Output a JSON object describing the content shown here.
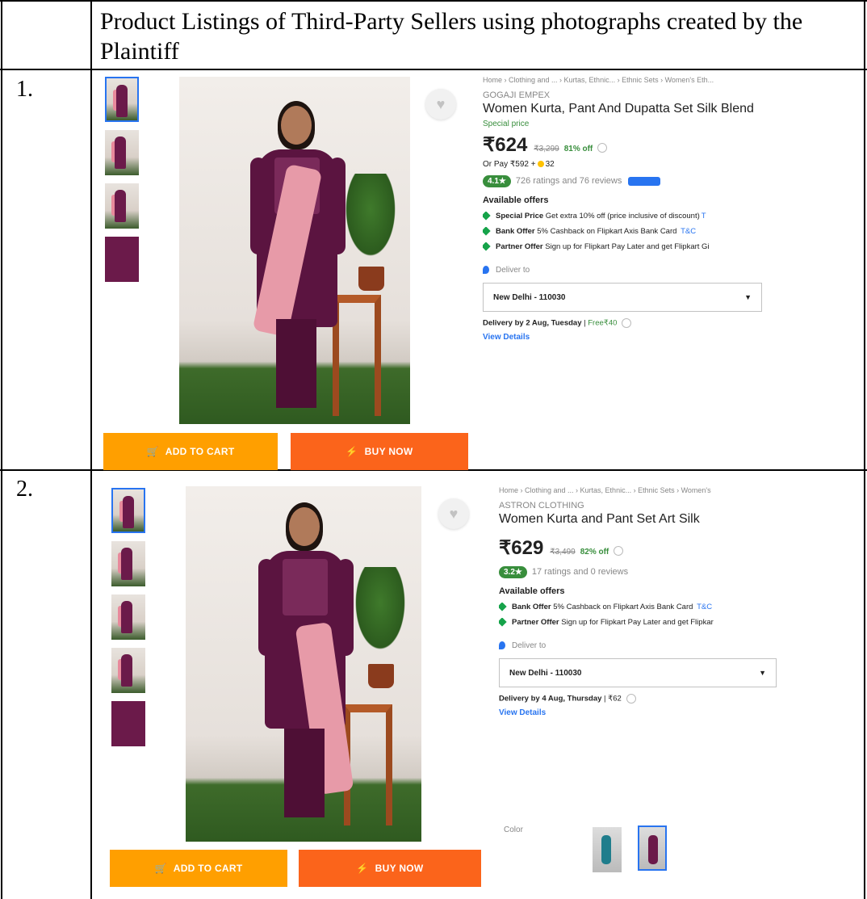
{
  "header": {
    "title": "Product Listings of Third-Party Sellers using photographs created by the Plaintiff"
  },
  "rows": [
    {
      "number": "1.",
      "breadcrumb": "Home › Clothing and ... › Kurtas, Ethnic... › Ethnic Sets › Women's Eth...",
      "brand": "GOGAJI EMPEX",
      "title": "Women Kurta, Pant And Dupatta Set Silk Blend",
      "special": "Special price",
      "price": "₹624",
      "mrp": "₹3,299",
      "off": "81% off",
      "or_pay": "Or Pay ₹592 +",
      "or_pay_coins": "32",
      "rating": "4.1★",
      "rating_text": "726 ratings and 76 reviews",
      "offers_heading": "Available offers",
      "offers": [
        {
          "bold": "Special Price",
          "text": " Get extra 10% off (price inclusive of discount)",
          "link": "T"
        },
        {
          "bold": "Bank Offer",
          "text": " 5% Cashback on Flipkart Axis Bank Card",
          "link": "T&C"
        },
        {
          "bold": "Partner Offer",
          "text": " Sign up for Flipkart Pay Later and get Flipkart Gi",
          "link": ""
        }
      ],
      "deliver_to": "Deliver to",
      "pincode": "New Delhi - 110030",
      "delivery_bold": "Delivery by 2 Aug, Tuesday",
      "delivery_sep": " | ",
      "delivery_fee": "Free₹40",
      "view_details": "View Details",
      "add_to_cart": "ADD TO CART",
      "buy_now": "BUY NOW"
    },
    {
      "number": "2.",
      "breadcrumb": "Home › Clothing and ... › Kurtas, Ethnic... › Ethnic Sets › Women's",
      "brand": "ASTRON CLOTHING",
      "title": "Women Kurta and Pant Set Art Silk",
      "price": "₹629",
      "mrp": "₹3,499",
      "off": "82% off",
      "rating": "3.2★",
      "rating_text": "17 ratings and 0 reviews",
      "offers_heading": "Available offers",
      "offers": [
        {
          "bold": "Bank Offer",
          "text": " 5% Cashback on Flipkart Axis Bank Card",
          "link": "T&C"
        },
        {
          "bold": "Partner Offer",
          "text": " Sign up for Flipkart Pay Later and get Flipkar",
          "link": ""
        }
      ],
      "deliver_to": "Deliver to",
      "pincode": "New Delhi - 110030",
      "delivery_bold": "Delivery by 4 Aug, Thursday",
      "delivery_sep": " | ",
      "delivery_fee": "₹62",
      "view_details": "View Details",
      "color_label": "Color",
      "add_to_cart": "ADD TO CART",
      "buy_now": "BUY NOW"
    }
  ],
  "colors": {
    "cart": "#ff9f00",
    "buy": "#fb641b",
    "rating_green": "#388e3c",
    "link_blue": "#2874f0"
  }
}
